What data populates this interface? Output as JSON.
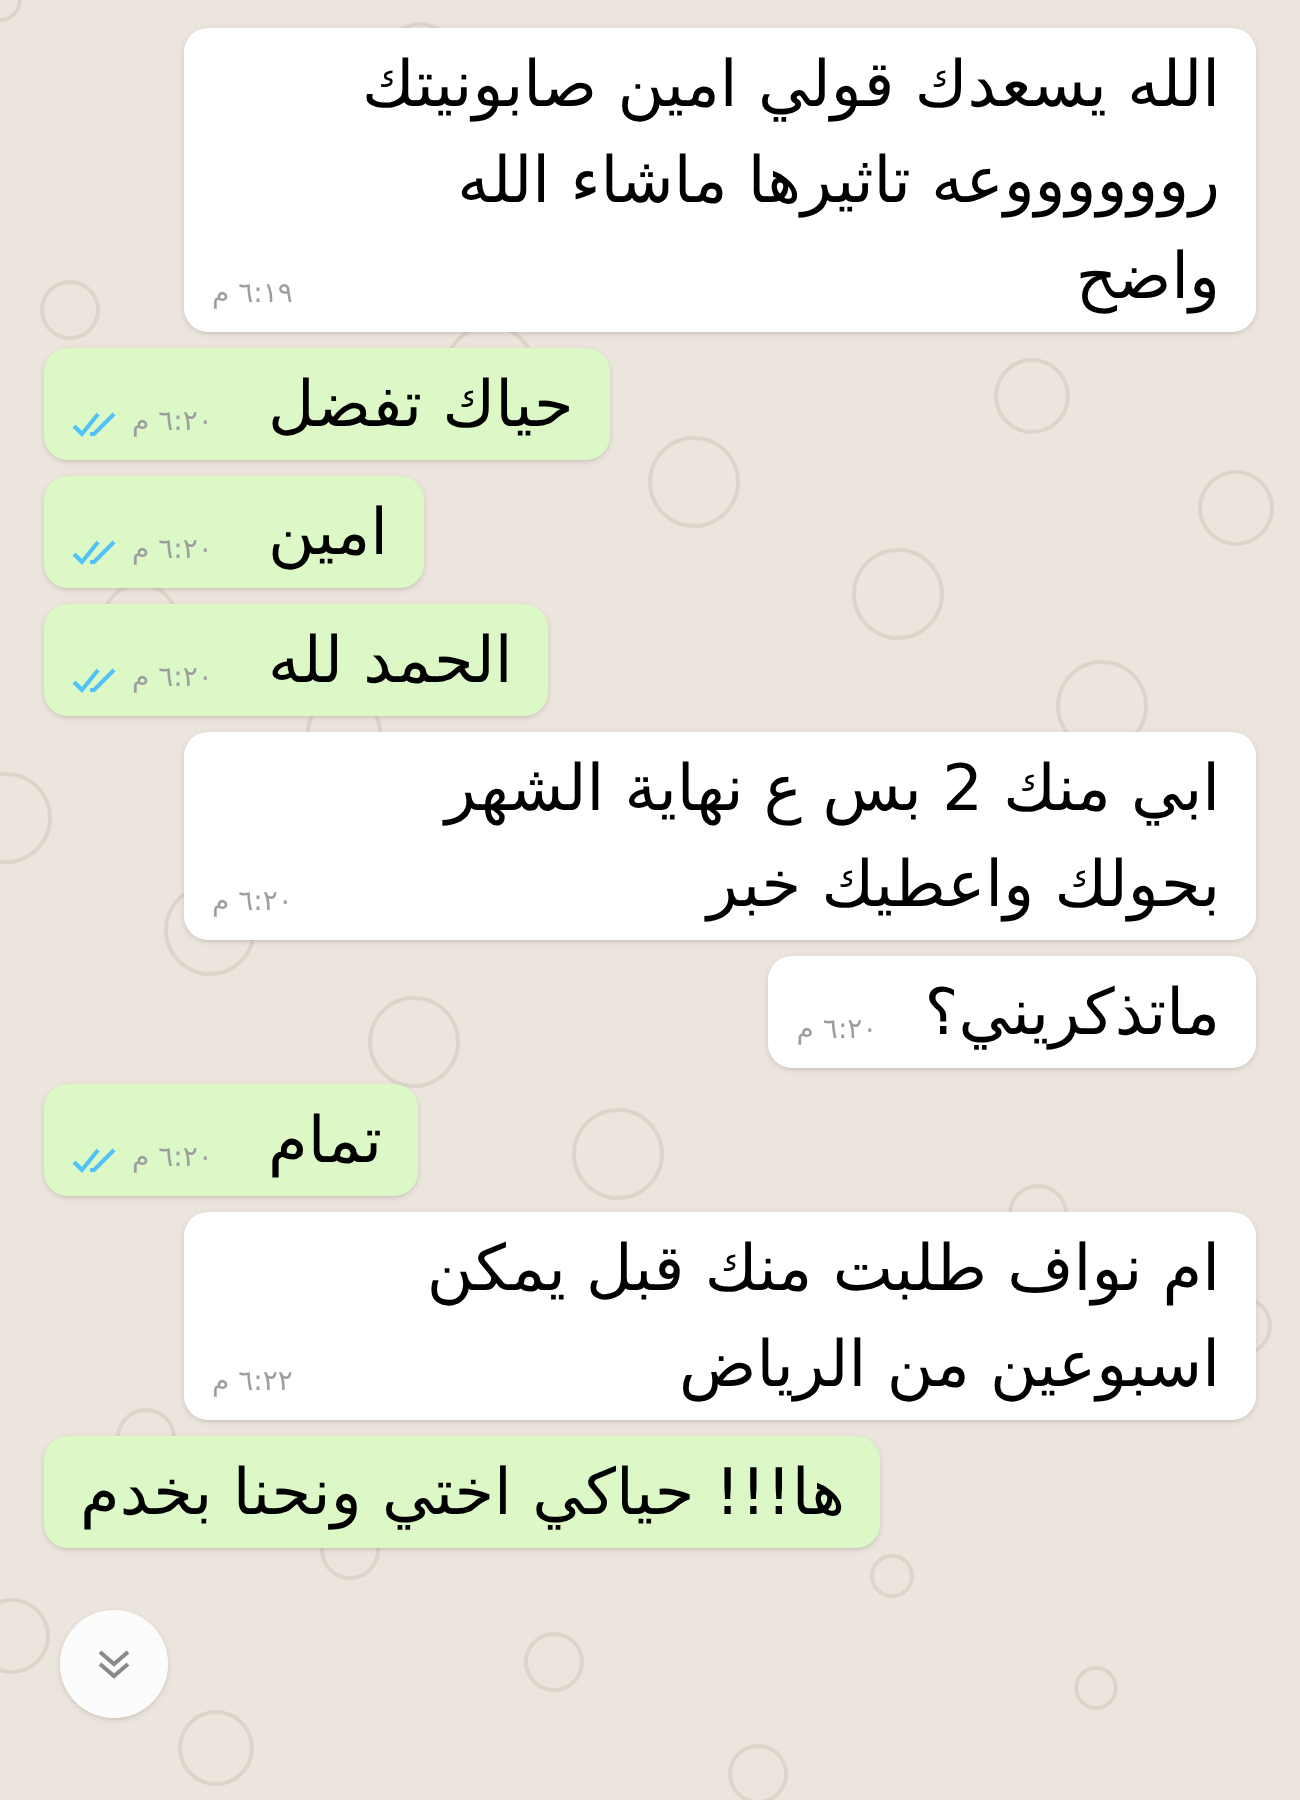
{
  "messages": [
    {
      "kind": "incoming",
      "text": "الله يسعدك قولي امين صابونيتك رووووووعه تاثيرها ماشاء الله واضح",
      "time": "٦:١٩ م"
    },
    {
      "kind": "outgoing",
      "text": "حياك تفضل",
      "time": "٦:٢٠ م",
      "read": true
    },
    {
      "kind": "outgoing",
      "text": "امين",
      "time": "٦:٢٠ م",
      "read": true
    },
    {
      "kind": "outgoing",
      "text": "الحمد لله",
      "time": "٦:٢٠ م",
      "read": true
    },
    {
      "kind": "incoming",
      "text": "ابي منك 2 بس ع نهاية الشهر بحولك واعطيك خبر",
      "time": "٦:٢٠ م"
    },
    {
      "kind": "incoming",
      "text": "ماتذكريني؟",
      "time": "٦:٢٠ م"
    },
    {
      "kind": "outgoing",
      "text": "تمام",
      "time": "٦:٢٠ م",
      "read": true
    },
    {
      "kind": "incoming",
      "text": "ام نواف طلبت منك قبل يمكن اسبوعين من الرياض",
      "time": "٦:٢٢ م"
    },
    {
      "kind": "outgoing",
      "text": "ها!!! حياكي اختي ونحنا بخدم"
    }
  ]
}
